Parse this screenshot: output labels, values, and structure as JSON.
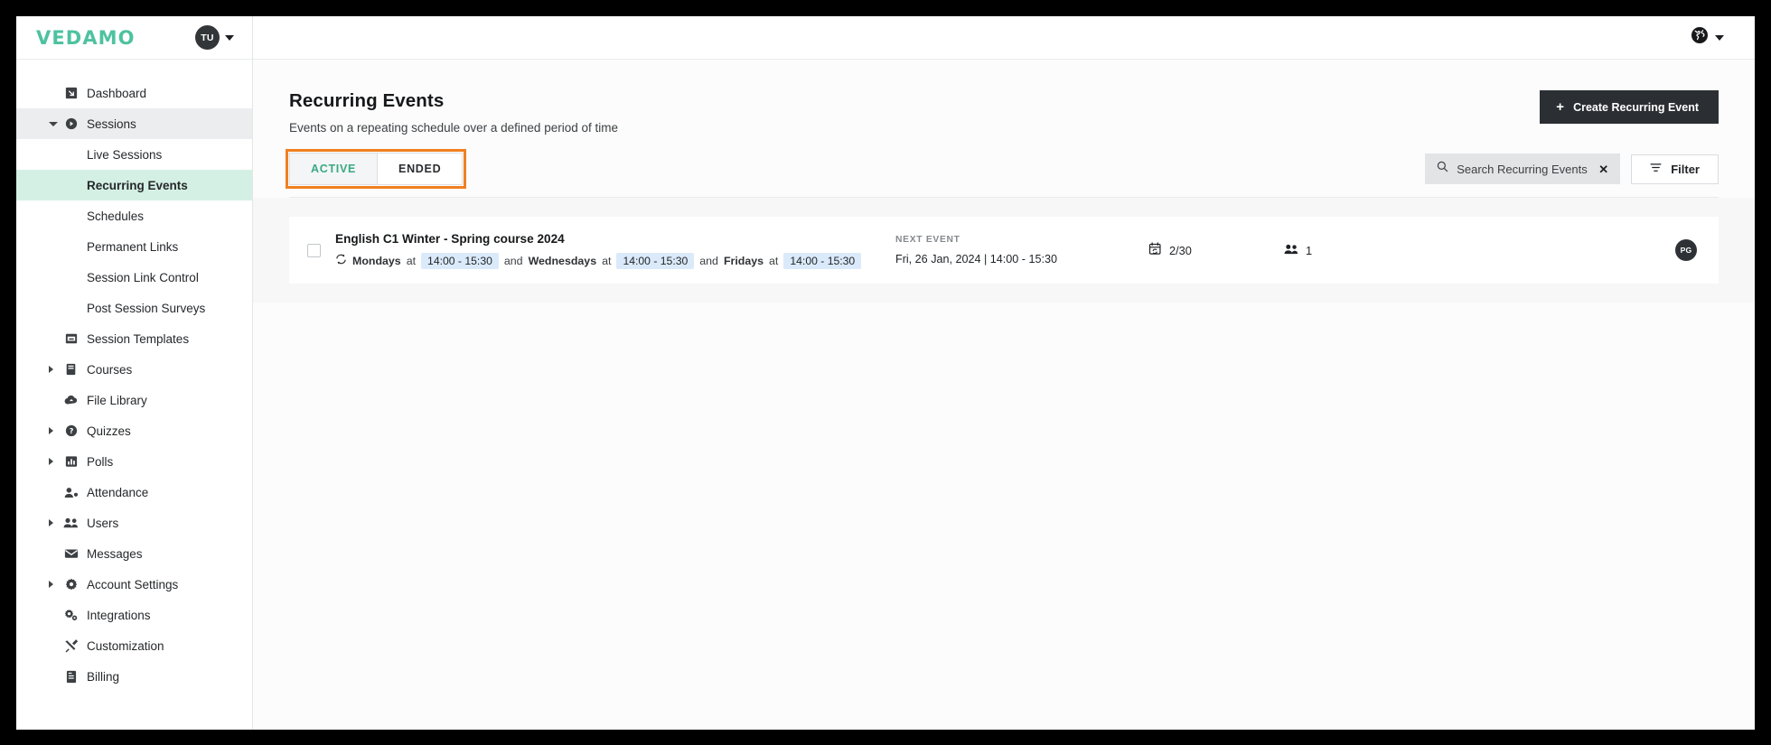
{
  "brand": {
    "logo": "VEDAMO",
    "logo_color": "#4ec2a0"
  },
  "header": {
    "user_initials": "TU",
    "language_icon": "globe-icon"
  },
  "sidebar": {
    "items": [
      {
        "label": "Dashboard",
        "icon": "dashboard-arrow-icon",
        "expandable": false
      },
      {
        "label": "Sessions",
        "icon": "play-circle-icon",
        "expandable": true,
        "expanded": true,
        "active": true
      },
      {
        "label": "Session Templates",
        "icon": "template-icon",
        "expandable": false
      },
      {
        "label": "Courses",
        "icon": "book-icon",
        "expandable": true
      },
      {
        "label": "File Library",
        "icon": "cloud-icon",
        "expandable": false
      },
      {
        "label": "Quizzes",
        "icon": "question-circle-icon",
        "expandable": true
      },
      {
        "label": "Polls",
        "icon": "bar-chart-icon",
        "expandable": true
      },
      {
        "label": "Attendance",
        "icon": "person-check-icon",
        "expandable": false
      },
      {
        "label": "Users",
        "icon": "people-icon",
        "expandable": true
      },
      {
        "label": "Messages",
        "icon": "envelope-icon",
        "expandable": false
      },
      {
        "label": "Account Settings",
        "icon": "gear-icon",
        "expandable": true
      },
      {
        "label": "Integrations",
        "icon": "gears-icon",
        "expandable": false
      },
      {
        "label": "Customization",
        "icon": "tools-icon",
        "expandable": false
      },
      {
        "label": "Billing",
        "icon": "receipt-icon",
        "expandable": false
      }
    ],
    "sessions_children": [
      {
        "label": "Live Sessions",
        "selected": false
      },
      {
        "label": "Recurring Events",
        "selected": true
      },
      {
        "label": "Schedules",
        "selected": false
      },
      {
        "label": "Permanent Links",
        "selected": false
      },
      {
        "label": "Session Link Control",
        "selected": false
      },
      {
        "label": "Post Session Surveys",
        "selected": false
      }
    ]
  },
  "page": {
    "title": "Recurring Events",
    "subtitle": "Events on a repeating schedule over a defined period of time",
    "create_button": "Create Recurring Event"
  },
  "tabs": [
    {
      "label": "ACTIVE",
      "selected": true
    },
    {
      "label": "ENDED",
      "selected": false
    }
  ],
  "highlight_color": "#f08020",
  "search": {
    "placeholder": "Search Recurring Events",
    "value": "",
    "clear_label": "✕",
    "icon": "search-icon"
  },
  "filter": {
    "label": "Filter",
    "icon": "funnel-icon"
  },
  "events": [
    {
      "title": "English C1 Winter - Spring course 2024",
      "recurrence": {
        "icon": "repeat-icon",
        "parts": [
          {
            "day": "Mondays",
            "at": "at",
            "time": "14:00 - 15:30"
          },
          {
            "conj": "and",
            "day": "Wednesdays",
            "at": "at",
            "time": "14:00 - 15:30"
          },
          {
            "conj": "and",
            "day": "Fridays",
            "at": "at",
            "time": "14:00 - 15:30"
          }
        ]
      },
      "next_event_label": "NEXT EVENT",
      "next_event_value": "Fri, 26 Jan, 2024 | 14:00 - 15:30",
      "occurrences": "2/30",
      "occurrences_icon": "calendar-repeat-icon",
      "participants": "1",
      "participants_icon": "people-icon",
      "owner_initials": "PG",
      "checked": false
    }
  ]
}
